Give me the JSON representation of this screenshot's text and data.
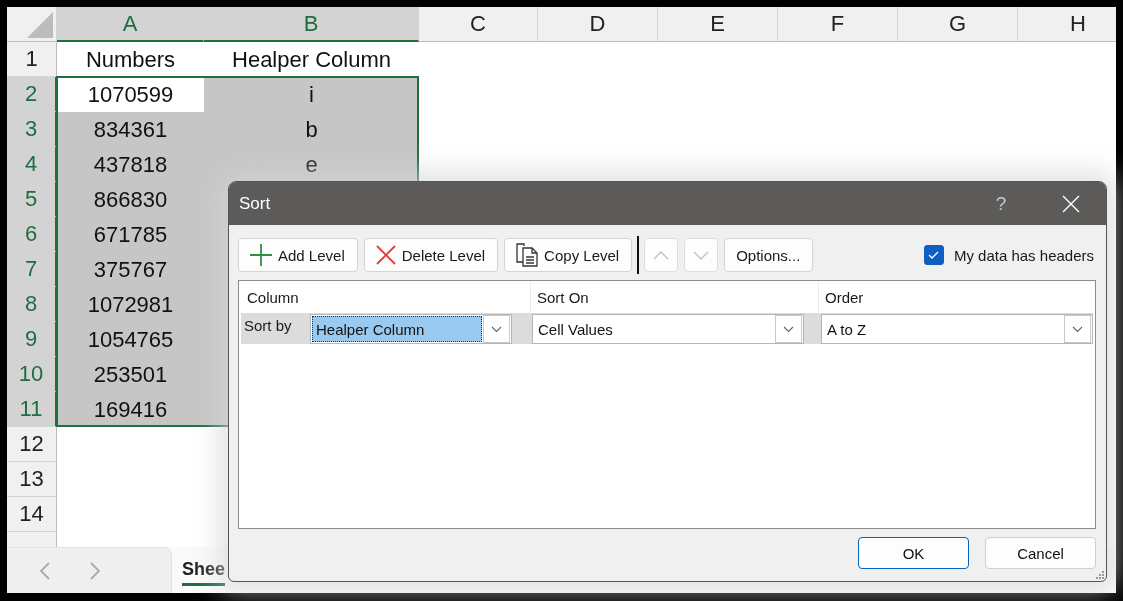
{
  "sheet": {
    "columns": [
      {
        "label": "A",
        "selected": true
      },
      {
        "label": "B",
        "selected": true
      },
      {
        "label": "C",
        "selected": false
      },
      {
        "label": "D",
        "selected": false
      },
      {
        "label": "E",
        "selected": false
      },
      {
        "label": "F",
        "selected": false
      },
      {
        "label": "G",
        "selected": false
      },
      {
        "label": "H",
        "selected": false
      }
    ],
    "rows": [
      {
        "label": "1",
        "selected": false,
        "cells": [
          {
            "text": "Numbers",
            "active": false
          },
          {
            "text": "Healper Column",
            "active": false
          }
        ]
      },
      {
        "label": "2",
        "selected": true,
        "cells": [
          {
            "text": "1070599",
            "active": true
          },
          {
            "text": "i",
            "active": false
          }
        ]
      },
      {
        "label": "3",
        "selected": true,
        "cells": [
          {
            "text": "834361",
            "active": false
          },
          {
            "text": "b",
            "active": false
          }
        ]
      },
      {
        "label": "4",
        "selected": true,
        "cells": [
          {
            "text": "437818",
            "active": false
          },
          {
            "text": "e",
            "active": false
          }
        ]
      },
      {
        "label": "5",
        "selected": true,
        "cells": [
          {
            "text": "866830",
            "active": false
          }
        ]
      },
      {
        "label": "6",
        "selected": true,
        "cells": [
          {
            "text": "671785",
            "active": false
          }
        ]
      },
      {
        "label": "7",
        "selected": true,
        "cells": [
          {
            "text": "375767",
            "active": false
          }
        ]
      },
      {
        "label": "8",
        "selected": true,
        "cells": [
          {
            "text": "1072981",
            "active": false
          }
        ]
      },
      {
        "label": "9",
        "selected": true,
        "cells": [
          {
            "text": "1054765",
            "active": false
          }
        ]
      },
      {
        "label": "10",
        "selected": true,
        "cells": [
          {
            "text": "253501",
            "active": false
          }
        ]
      },
      {
        "label": "11",
        "selected": true,
        "cells": [
          {
            "text": "169416",
            "active": false
          }
        ]
      },
      {
        "label": "12",
        "selected": false
      },
      {
        "label": "13",
        "selected": false
      },
      {
        "label": "14",
        "selected": false
      }
    ]
  },
  "sheet_tabs": {
    "tabs": [
      {
        "label": "Shee",
        "selected": true
      }
    ]
  },
  "dialog": {
    "title": "Sort",
    "help_label": "?",
    "toolbar": [
      {
        "kind": "add",
        "label": "Add Level",
        "disabled": false
      },
      {
        "kind": "delete",
        "label": "Delete Level",
        "disabled": false
      },
      {
        "kind": "copy",
        "label": "Copy Level",
        "disabled": false
      },
      {
        "kind": "move_up",
        "disabled": true
      },
      {
        "kind": "move_down",
        "disabled": true
      },
      {
        "kind": "options",
        "label": "Options...",
        "disabled": false
      }
    ],
    "headers_checkbox": {
      "label": "My data has headers",
      "checked": true
    },
    "columns": [
      "Column",
      "Sort On",
      "Order"
    ],
    "levels": [
      {
        "label": "Sort by",
        "selected": true,
        "column": {
          "value": "Healper Column",
          "focused": true
        },
        "sort_on": {
          "value": "Cell Values",
          "focused": false
        },
        "order": {
          "value": "A to Z",
          "focused": false
        }
      }
    ],
    "buttons": [
      {
        "label": "OK",
        "default": true
      },
      {
        "label": "Cancel",
        "default": false
      }
    ]
  }
}
